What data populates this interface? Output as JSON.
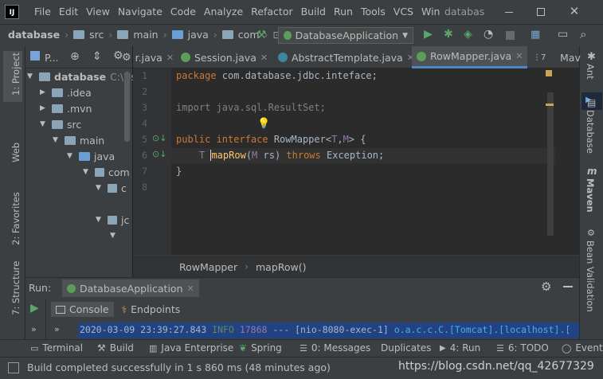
{
  "title_bar": {
    "menus": [
      "File",
      "Edit",
      "View",
      "Navigate",
      "Code",
      "Analyze",
      "Refactor",
      "Build",
      "Run",
      "Tools",
      "VCS",
      "Win"
    ],
    "project_name": "databas",
    "window_controls": [
      "minimize",
      "maximize",
      "close"
    ]
  },
  "nav_bar": {
    "crumbs": [
      "database",
      "src",
      "main",
      "java",
      "com"
    ],
    "run_config": "DatabaseApplication"
  },
  "left_strip": {
    "project": "1: Project",
    "web": "Web",
    "favorites": "2: Favorites",
    "structure": "7: Structure"
  },
  "right_strip": {
    "ant": "Ant",
    "database": "Database",
    "maven": "Maven",
    "bean": "Bean Validation"
  },
  "project_tool": {
    "label": "P..."
  },
  "tree": {
    "root": "database",
    "root_path": "C:\\Use",
    "items": [
      ".idea",
      ".mvn",
      "src",
      "main",
      "java",
      "com",
      "c",
      "jc"
    ]
  },
  "editor_tabs": [
    {
      "label": "r.java"
    },
    {
      "label": "Session.java"
    },
    {
      "label": "AbstractTemplate.java"
    },
    {
      "label": "RowMapper.java",
      "active": true
    },
    {
      "label": "⋮7"
    },
    {
      "label": "Mav"
    }
  ],
  "code": {
    "line_numbers": [
      "1",
      "2",
      "3",
      "4",
      "5",
      "6",
      "7",
      "8"
    ],
    "l1_kw": "package",
    "l1_rest": " com.database.jdbc.inteface;",
    "l3_kw": "import",
    "l3_rest": " java.sql.ResultSet;",
    "l5_kw1": "public",
    "l5_kw2": " interface",
    "l5_name": " RowMapper<",
    "l5_t": "T",
    "l5_c": ",",
    "l5_m": "M",
    "l5_end": "> {",
    "l6_t": "T ",
    "l6_fn": "mapRow",
    "l6_p": "(",
    "l6_m": "M",
    "l6_rs": " rs) ",
    "l6_kw": "throws",
    "l6_ex": " Exception;",
    "l7": "}"
  },
  "breadcrumb": {
    "class": "RowMapper",
    "method": "mapRow()"
  },
  "run_panel": {
    "label": "Run:",
    "config": "DatabaseApplication",
    "tabs": [
      "Console",
      "Endpoints"
    ],
    "log_time": "2020-03-09 23:39:27.843",
    "log_level": "INFO",
    "log_pid": "17868",
    "log_sep": "--- [nio-8080-exec-1]",
    "log_logger": "o.a.c.c.C.[Tomcat].[localhost].["
  },
  "bottom_tools": [
    "Terminal",
    "Build",
    "Java Enterprise",
    "Spring",
    "0: Messages",
    "Duplicates",
    "4: Run",
    "6: TODO",
    "Event"
  ],
  "status": {
    "message": "Build completed successfully in 1 s 860 ms (48 minutes ago)",
    "watermark": "https://blog.csdn.net/qq_42677329"
  },
  "colors": {
    "background": "#2b2b2b",
    "panel": "#3c3f41",
    "accent": "#4a88c7",
    "keyword": "#cc7832",
    "run_green": "#59a869"
  }
}
